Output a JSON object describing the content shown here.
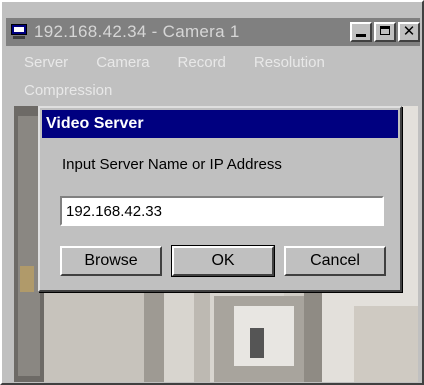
{
  "window": {
    "title": "192.168.42.34 - Camera 1"
  },
  "titlebar_buttons": {
    "close_label": "✕"
  },
  "menu": {
    "items": [
      "Server",
      "Camera",
      "Record",
      "Resolution",
      "Compression"
    ]
  },
  "dialog": {
    "title": "Video Server",
    "prompt": "Input Server Name or IP Address",
    "input_value": "192.168.42.33",
    "buttons": {
      "browse": "Browse",
      "ok": "OK",
      "cancel": "Cancel"
    }
  },
  "colors": {
    "dialog_title_bg": "#000080",
    "window_bg": "#c0c0c0",
    "inactive_titlebar": "#808080"
  }
}
